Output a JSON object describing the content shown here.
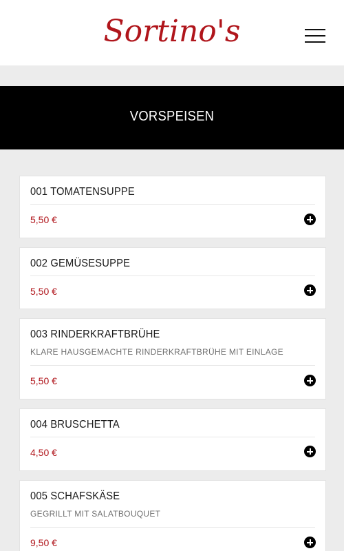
{
  "header": {
    "logo_text": "Sortino's",
    "menu_icon": "hamburger-menu-icon"
  },
  "section": {
    "title": "VORSPEISEN"
  },
  "items": [
    {
      "name": "001 TOMATENSUPPE",
      "description": "",
      "price": "5,50 €"
    },
    {
      "name": "002 GEMÜSESUPPE",
      "description": "",
      "price": "5,50 €"
    },
    {
      "name": "003 RINDERKRAFTBRÜHE",
      "description": "KLARE HAUSGEMACHTE RINDERKRAFTBRÜHE MIT EINLAGE",
      "price": "5,50 €"
    },
    {
      "name": "004 BRUSCHETTA",
      "description": "",
      "price": "4,50 €"
    },
    {
      "name": "005 SCHAFSKÄSE",
      "description": "GEGRILLT MIT SALATBOUQUET",
      "price": "9,50 €"
    }
  ],
  "colors": {
    "brand": "#b0151b",
    "band": "#000000",
    "background": "#ececec"
  }
}
